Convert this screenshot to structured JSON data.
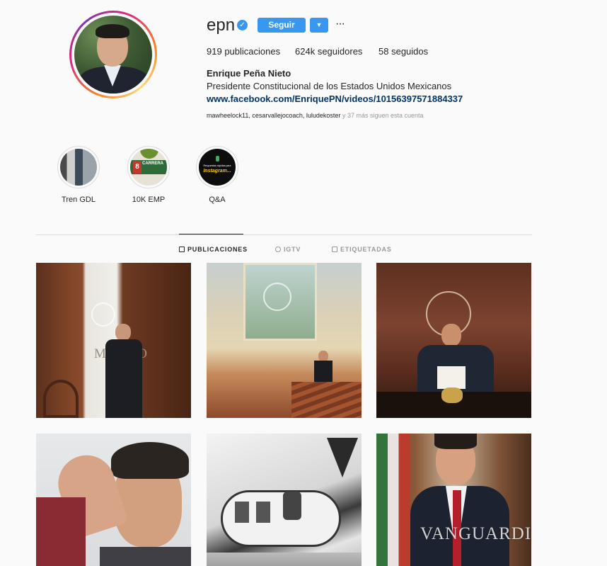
{
  "profile": {
    "username": "epn",
    "verified_icon": "verified-check-icon",
    "follow_label": "Seguir",
    "dropdown_icon": "▼",
    "more_icon": "···",
    "stats": {
      "posts": "919",
      "posts_label": "publicaciones",
      "followers": "624k",
      "followers_label": "seguidores",
      "following": "58",
      "following_label": "seguidos"
    },
    "full_name": "Enrique Peña Nieto",
    "bio": "Presidente Constitucional de los Estados Unidos Mexicanos",
    "link": "www.facebook.com/EnriquePN/videos/10156397571884337",
    "followed_by_names": "mawheelock11, cesarvallejocoach, luludekoster",
    "followed_by_more": " y 37 más siguen esta cuenta"
  },
  "highlights": [
    {
      "label": "Tren GDL"
    },
    {
      "label": "10K EMP",
      "badge_number": "8",
      "badge_text": "CARRERA"
    },
    {
      "label": "Q&A",
      "line1": "Respuestas rápidas para",
      "line2": "Instagram..."
    }
  ],
  "tabs": [
    {
      "label": "PUBLICACIONES",
      "icon": "grid-icon",
      "active": true
    },
    {
      "label": "IGTV",
      "icon": "igtv-icon",
      "active": false
    },
    {
      "label": "ETIQUETADAS",
      "icon": "tagged-icon",
      "active": false
    }
  ],
  "posts": {
    "p1_sign": "MEXICO",
    "watermark": "VANGUARDIA"
  },
  "colors": {
    "accent": "#3897f0",
    "text": "#262626",
    "muted": "#999999",
    "link": "#003569",
    "background": "#fafafa"
  }
}
